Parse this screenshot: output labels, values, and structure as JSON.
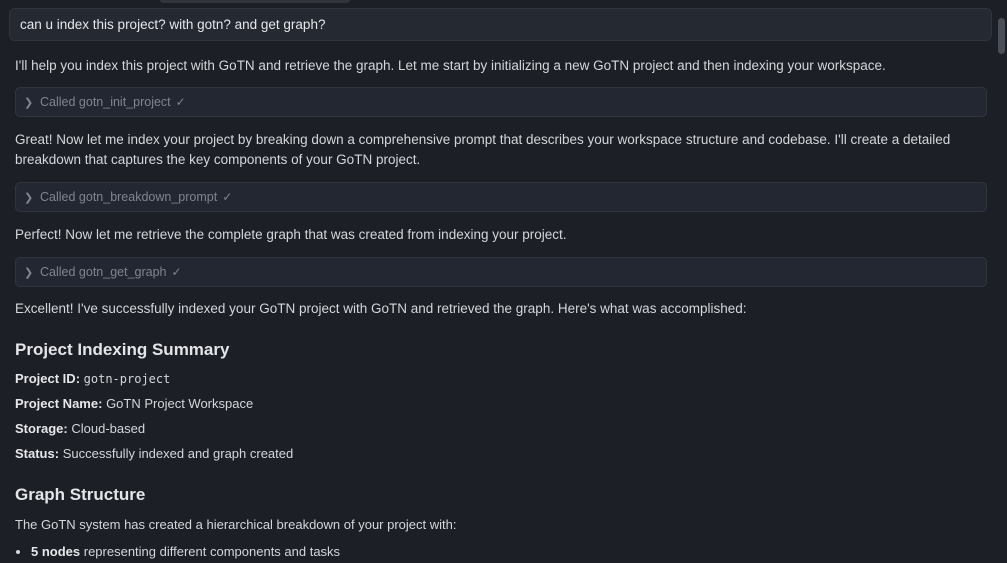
{
  "chat": {
    "user_message": "can u index this project? with gotn? and get graph?",
    "responses": {
      "intro": "I'll help you index this project with GoTN and retrieve the graph. Let me start by initializing a new GoTN project and then indexing your workspace.",
      "after_init": "Great! Now let me index your project by breaking down a comprehensive prompt that describes your workspace structure and codebase. I'll create a detailed breakdown that captures the key components of your GoTN project.",
      "after_breakdown": "Perfect! Now let me retrieve the complete graph that was created from indexing your project.",
      "after_graph": "Excellent! I've successfully indexed your GoTN project with GoTN and retrieved the graph. Here's what was accomplished:"
    },
    "tool_calls": [
      {
        "label": "Called gotn_init_project",
        "check": "✓"
      },
      {
        "label": "Called gotn_breakdown_prompt",
        "check": "✓"
      },
      {
        "label": "Called gotn_get_graph",
        "check": "✓"
      }
    ],
    "summary": {
      "heading": "Project Indexing Summary",
      "fields": [
        {
          "label": "Project ID",
          "sep": ":",
          "value": "gotn-project"
        },
        {
          "label": "Project Name",
          "sep": ":",
          "value": "GoTN Project Workspace"
        },
        {
          "label": "Storage",
          "sep": ":",
          "value": "Cloud-based"
        },
        {
          "label": "Status",
          "sep": ":",
          "value": "Successfully indexed and graph created"
        }
      ]
    },
    "graph": {
      "heading": "Graph Structure",
      "intro": "The GoTN system has created a hierarchical breakdown of your project with:",
      "bullets": [
        {
          "strong": "5 nodes",
          "rest": "representing different components and tasks"
        }
      ]
    }
  }
}
